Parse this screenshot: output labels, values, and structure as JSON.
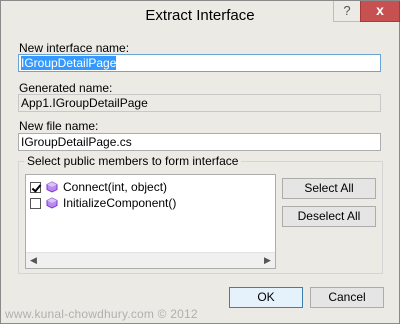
{
  "window": {
    "title": "Extract Interface",
    "help_label": "?",
    "close_label": "x"
  },
  "fields": {
    "interface_name_label": "New interface name:",
    "interface_name_value": "IGroupDetailPage",
    "generated_name_label": "Generated name:",
    "generated_name_value": "App1.IGroupDetailPage",
    "file_name_label": "New file name:",
    "file_name_value": "IGroupDetailPage.cs"
  },
  "members": {
    "group_label": "Select public members to form interface",
    "items": [
      {
        "label": "Connect(int, object)",
        "checked": true,
        "icon": "method-icon"
      },
      {
        "label": "InitializeComponent()",
        "checked": false,
        "icon": "method-icon"
      }
    ],
    "select_all_label": "Select All",
    "deselect_all_label": "Deselect All"
  },
  "footer": {
    "ok_label": "OK",
    "cancel_label": "Cancel"
  },
  "watermark": "www.kunal-chowdhury.com © 2012",
  "colors": {
    "dialog_bg": "#eceae5",
    "close_button": "#c75050",
    "selection": "#3399ff",
    "method_icon": "#8a2be2"
  }
}
